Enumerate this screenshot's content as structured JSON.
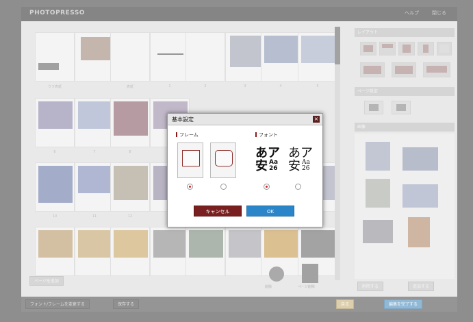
{
  "app": {
    "logo": "PHOTOPRESSO",
    "top_buttons": [
      "ヘルプ",
      "閉じる"
    ]
  },
  "pages": {
    "labels": [
      "ウラ表紙",
      "表紙",
      "1",
      "2",
      "3",
      "4",
      "5",
      "6",
      "7",
      "8",
      "9",
      "10",
      "11",
      "12",
      "13",
      "14",
      "15",
      "16",
      "17",
      "18",
      "19",
      "20",
      "21",
      "22",
      "23"
    ]
  },
  "sidebar": {
    "layout_title": "レイアウト",
    "page_title": "ページ設定",
    "images_title": "画像",
    "buttons": [
      "削除する",
      "追加する"
    ]
  },
  "bottom": {
    "left_buttons": [
      "フォント/フレームを変更する",
      "保存する"
    ],
    "right_buttons": [
      "戻る",
      "編集を完了する"
    ],
    "icons": [
      "削除",
      "ページ削除"
    ],
    "small_button": "ページを追加"
  },
  "dialog": {
    "title": "基本設定",
    "close_icon": "×",
    "frame_section": "フレーム",
    "font_section": "フォント",
    "font_sample_1_big": "あア",
    "font_sample_1_sub_kanji": "安",
    "font_sample_1_sub_latin": "Aa",
    "font_sample_1_sub_num": "26",
    "font_sample_2_big": "あア",
    "font_sample_2_sub_kanji": "安",
    "font_sample_2_sub_latin": "Aa",
    "font_sample_2_sub_num": "26",
    "cancel": "キャンセル",
    "ok": "OK",
    "frame_selected": 1,
    "font_selected": 1
  },
  "colors": {
    "accent_red": "#7a1f1f",
    "ok_blue": "#2a86c9",
    "radio_on": "#cc2222"
  }
}
